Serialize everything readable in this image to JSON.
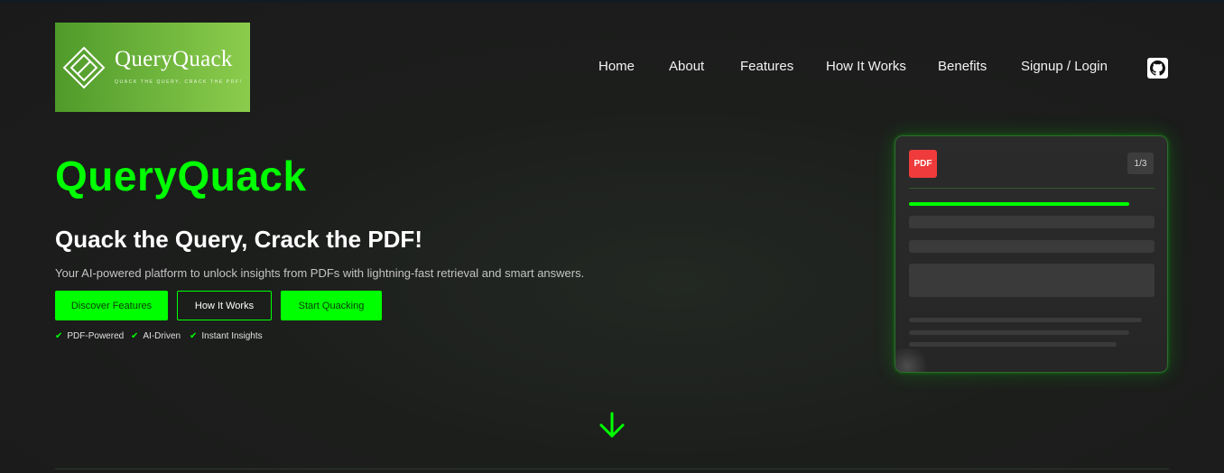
{
  "brand": {
    "logo_name": "QueryQuack",
    "logo_tagline": "Quack the Query, Crack the PDF!"
  },
  "nav": {
    "items": [
      {
        "label": "Home"
      },
      {
        "label": "About"
      },
      {
        "label": "Features"
      },
      {
        "label": "How It Works"
      },
      {
        "label": "Benefits"
      },
      {
        "label": "Signup / Login"
      }
    ],
    "github_icon": "github-icon"
  },
  "hero": {
    "title": "QueryQuack",
    "subtitle": "Quack the Query, Crack the PDF!",
    "description": "Your AI-powered platform to unlock insights from PDFs with lightning-fast retrieval and smart answers.",
    "buttons": [
      {
        "label": "Discover Features",
        "style": "filled"
      },
      {
        "label": "How It Works",
        "style": "outline"
      },
      {
        "label": "Start Quacking",
        "style": "filled"
      }
    ],
    "checks": [
      {
        "label": "PDF-Powered"
      },
      {
        "label": "AI-Driven"
      },
      {
        "label": "Instant Insights"
      }
    ],
    "check_glyph": "✔"
  },
  "pdf_card": {
    "badge": "PDF",
    "page_indicator": "1/3"
  },
  "colors": {
    "accent": "#00ff00",
    "background": "#1a1a1a",
    "card": "#2a2a2a",
    "pdf_badge": "#ef3b3b"
  },
  "icons": {
    "scroll": "arrow-down-icon",
    "logo": "diamond-logo-icon",
    "check": "check-icon"
  }
}
